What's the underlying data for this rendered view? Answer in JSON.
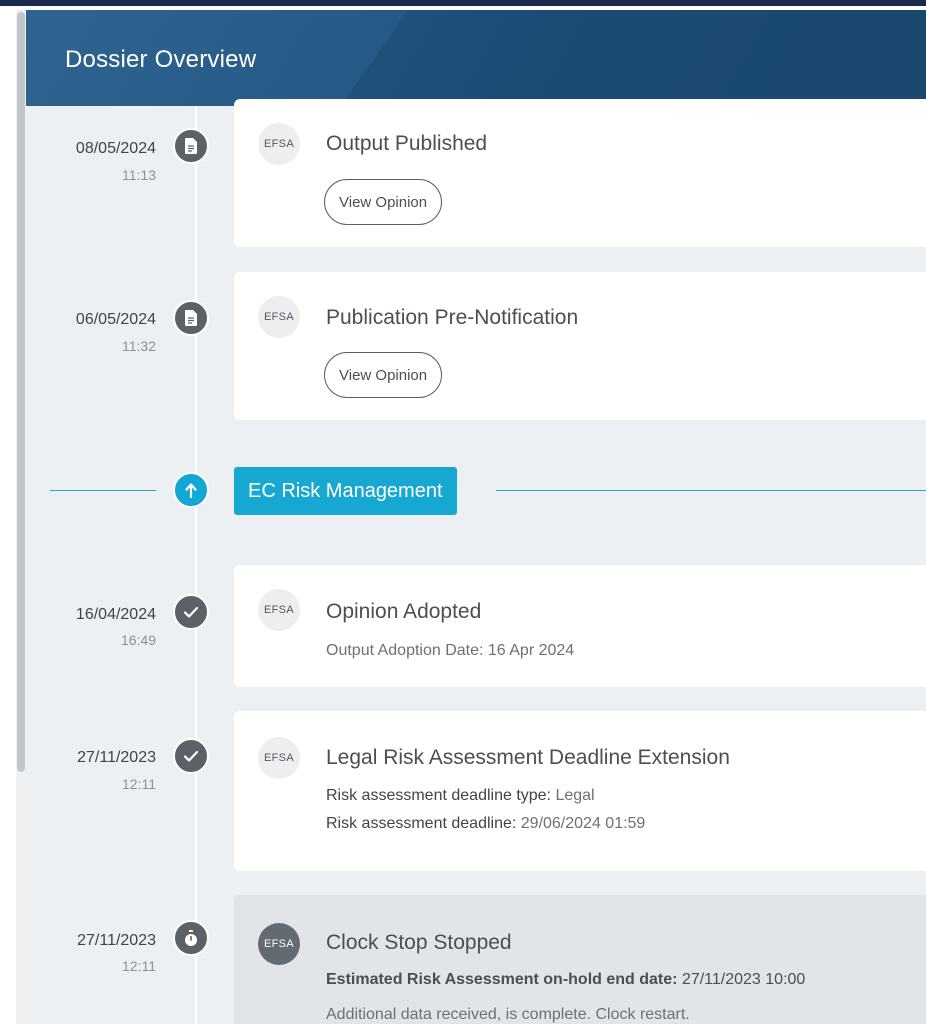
{
  "header": {
    "title": "Dossier Overview"
  },
  "phase": {
    "label": "EC Risk Management"
  },
  "events": [
    {
      "date": "08/05/2024",
      "time": "11:13",
      "icon": "document-icon",
      "badge": "EFSA",
      "title": "Output Published",
      "button": "View Opinion"
    },
    {
      "date": "06/05/2024",
      "time": "11:32",
      "icon": "document-icon",
      "badge": "EFSA",
      "title": "Publication Pre-Notification",
      "button": "View Opinion"
    },
    {
      "date": "16/04/2024",
      "time": "16:49",
      "icon": "check-icon",
      "badge": "EFSA",
      "title": "Opinion Adopted",
      "text": "Output Adoption Date: 16 Apr 2024"
    },
    {
      "date": "27/11/2023",
      "time": "12:11",
      "icon": "check-icon",
      "badge": "EFSA",
      "title": "Legal Risk Assessment Deadline Extension",
      "details": [
        {
          "key": "Risk assessment deadline type:",
          "value": "Legal"
        },
        {
          "key": "Risk assessment deadline:",
          "value": "29/06/2024 01:59"
        }
      ]
    },
    {
      "date": "27/11/2023",
      "time": "12:11",
      "icon": "stopwatch-icon",
      "badge": "EFSA",
      "title": "Clock Stop Stopped",
      "details": [
        {
          "key": "Estimated Risk Assessment on-hold end date:",
          "value": "27/11/2023 10:00"
        }
      ],
      "text": "Additional data received, is complete. Clock restart."
    }
  ],
  "colors": {
    "header": "#275a86",
    "accent": "#17a8d2",
    "node": "#5c6168",
    "panel": "#edf0f3"
  }
}
